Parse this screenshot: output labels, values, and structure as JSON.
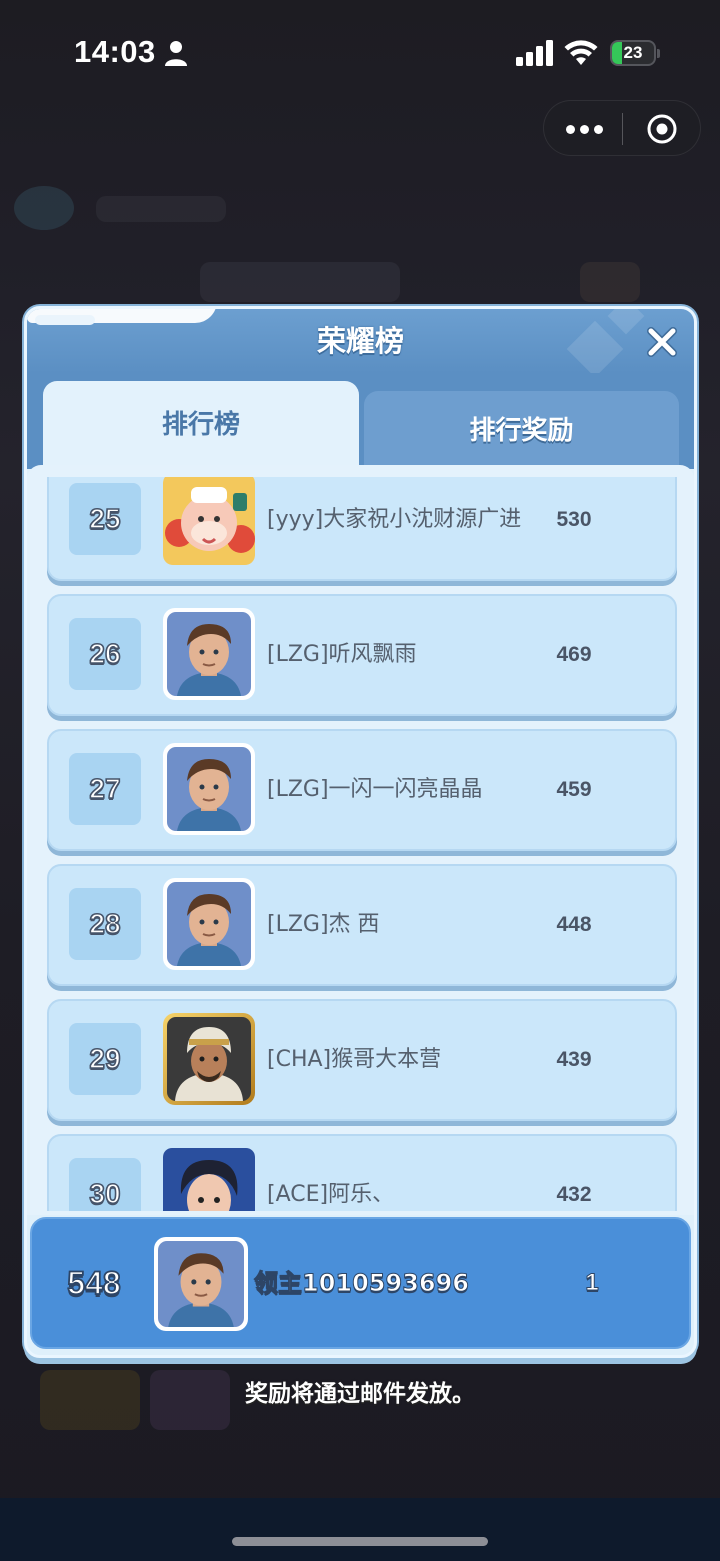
{
  "status_bar": {
    "time": "14:03",
    "battery": "23",
    "battery_level": 0.23
  },
  "dialog": {
    "title": "荣耀榜",
    "tabs": [
      {
        "label": "排行榜",
        "active": true
      },
      {
        "label": "排行奖励",
        "active": false
      }
    ],
    "rows": [
      {
        "rank": "25",
        "name": "[yyy]大家祝小沈财源广进",
        "score": "530",
        "avatar": "festive-mascot"
      },
      {
        "rank": "26",
        "name": "[LZG]听风飘雨",
        "score": "469",
        "avatar": "default-lord"
      },
      {
        "rank": "27",
        "name": "[LZG]一闪一闪亮晶晶",
        "score": "459",
        "avatar": "default-lord"
      },
      {
        "rank": "28",
        "name": "[LZG]杰 西",
        "score": "448",
        "avatar": "default-lord"
      },
      {
        "rank": "29",
        "name": "[CHA]猴哥大本营",
        "score": "439",
        "avatar": "desert-warrior"
      },
      {
        "rank": "30",
        "name": "[ACE]阿乐、",
        "score": "432",
        "avatar": "anime-boy"
      }
    ],
    "self": {
      "rank": "548",
      "name": "领主1010593696",
      "score": "1"
    }
  },
  "footer": {
    "note": "奖励将通过邮件发放。"
  },
  "colors": {
    "header": "#5b8fc3",
    "row_bg": "#cbe7fa",
    "self_row": "#4a8fd9"
  }
}
